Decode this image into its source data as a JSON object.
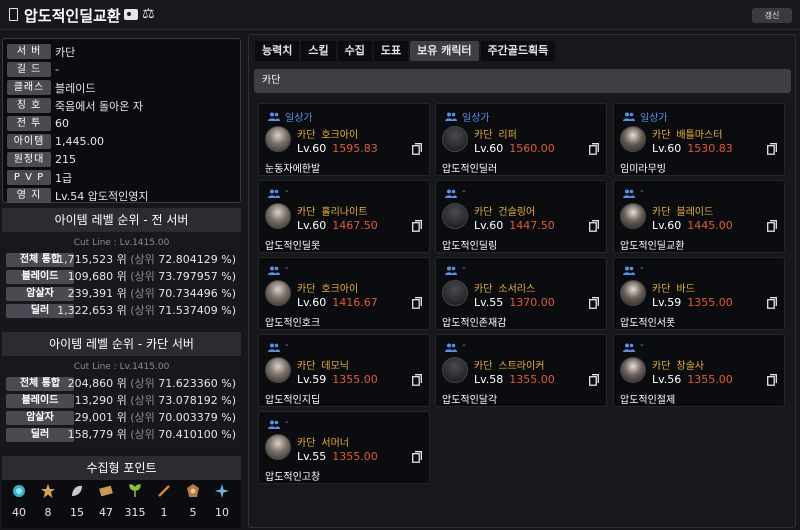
{
  "header": {
    "title": "압도적인딜교환",
    "refresh_label": "갱신"
  },
  "info": [
    {
      "label": "서 버",
      "value": "카단"
    },
    {
      "label": "길 드",
      "value": "-"
    },
    {
      "label": "클래스",
      "value": "블레이드"
    },
    {
      "label": "칭 호",
      "value": "죽음에서 돌아온 자"
    },
    {
      "label": "전 투",
      "value": "60"
    },
    {
      "label": "아이템",
      "value": "1,445.00"
    },
    {
      "label": "원정대",
      "value": "215"
    },
    {
      "label": "P V P",
      "value": "1급"
    },
    {
      "label": "영 지",
      "value": "Lv.54 압도적인영지"
    }
  ],
  "rank_all": {
    "title": "아이템 레벨 순위 - 전 서버",
    "cutline": "Cut Line : Lv.1415.00",
    "rows": [
      {
        "label": "전체 통합",
        "rank": "1,715,523 위",
        "pct_label": "(상위",
        "pct": "72.804129 %)"
      },
      {
        "label": "블레이드",
        "rank": "109,680 위",
        "pct_label": "(상위",
        "pct": "73.797957 %)"
      },
      {
        "label": "암살자",
        "rank": "239,391 위",
        "pct_label": "(상위",
        "pct": "70.734496 %)"
      },
      {
        "label": "딜러",
        "rank": "1,322,653 위",
        "pct_label": "(상위",
        "pct": "71.537409 %)"
      }
    ]
  },
  "rank_server": {
    "title": "아이템 레벨 순위 - 카단 서버",
    "cutline": "Cut Line : Lv.1415.00",
    "rows": [
      {
        "label": "전체 통합",
        "rank": "204,860 위",
        "pct_label": "(상위",
        "pct": "71.623360 %)"
      },
      {
        "label": "블레이드",
        "rank": "13,290 위",
        "pct_label": "(상위",
        "pct": "73.078192 %)"
      },
      {
        "label": "암살자",
        "rank": "29,001 위",
        "pct_label": "(상위",
        "pct": "70.003379 %)"
      },
      {
        "label": "딜러",
        "rank": "158,779 위",
        "pct_label": "(상위",
        "pct": "70.410100 %)"
      }
    ]
  },
  "collection": {
    "title": "수집형 포인트",
    "items": [
      {
        "icon": "seed-icon",
        "count": "40",
        "color": "#3fb0c9"
      },
      {
        "icon": "star-icon",
        "count": "8",
        "color": "#d8a04a"
      },
      {
        "icon": "leaf-icon",
        "count": "15",
        "color": "#c9c9c9"
      },
      {
        "icon": "painting-icon",
        "count": "47",
        "color": "#c79a55"
      },
      {
        "icon": "sprout-icon",
        "count": "315",
        "color": "#8fbf3a"
      },
      {
        "icon": "medal-icon",
        "count": "1",
        "color": "#d7892f"
      },
      {
        "icon": "emblem-icon",
        "count": "5",
        "color": "#b07a4a"
      },
      {
        "icon": "compass-icon",
        "count": "10",
        "color": "#6fb7e8"
      }
    ]
  },
  "tabs": [
    "능력치",
    "스킬",
    "수집",
    "도표",
    "보유 캐릭터",
    "주간골드획득"
  ],
  "active_tab": 4,
  "server_name": "카단",
  "characters": [
    {
      "guild": "일상가",
      "server": "카단",
      "cls": "호크아이",
      "lv": "Lv.60",
      "ilv": "1595.83",
      "name": "눈동자에한발"
    },
    {
      "guild": "일상가",
      "server": "카단",
      "cls": "리퍼",
      "lv": "Lv.60",
      "ilv": "1560.00",
      "name": "압도적인딜러"
    },
    {
      "guild": "일상가",
      "server": "카단",
      "cls": "배틀마스터",
      "lv": "Lv.60",
      "ilv": "1530.83",
      "name": "임미라무빙"
    },
    {
      "guild": "-",
      "server": "카단",
      "cls": "홀리나이트",
      "lv": "Lv.60",
      "ilv": "1467.50",
      "name": "압도적인딜못"
    },
    {
      "guild": "-",
      "server": "카단",
      "cls": "건슬링어",
      "lv": "Lv.60",
      "ilv": "1447.50",
      "name": "압도적인딜링"
    },
    {
      "guild": "-",
      "server": "카단",
      "cls": "블레이드",
      "lv": "Lv.60",
      "ilv": "1445.00",
      "name": "압도적인딜교환"
    },
    {
      "guild": "-",
      "server": "카단",
      "cls": "호크아이",
      "lv": "Lv.60",
      "ilv": "1416.67",
      "name": "압도적인호크"
    },
    {
      "guild": "-",
      "server": "카단",
      "cls": "소서리스",
      "lv": "Lv.55",
      "ilv": "1370.00",
      "name": "압도적인존재감"
    },
    {
      "guild": "-",
      "server": "카단",
      "cls": "바드",
      "lv": "Lv.59",
      "ilv": "1355.00",
      "name": "압도적인서폿"
    },
    {
      "guild": "-",
      "server": "카단",
      "cls": "데모닉",
      "lv": "Lv.59",
      "ilv": "1355.00",
      "name": "압도적인지딥"
    },
    {
      "guild": "-",
      "server": "카단",
      "cls": "스트라이커",
      "lv": "Lv.58",
      "ilv": "1355.00",
      "name": "압도적인달각"
    },
    {
      "guild": "-",
      "server": "카단",
      "cls": "창술사",
      "lv": "Lv.56",
      "ilv": "1355.00",
      "name": "압도적인절제"
    },
    {
      "guild": "-",
      "server": "카단",
      "cls": "서머너",
      "lv": "Lv.55",
      "ilv": "1355.00",
      "name": "압도적인고창"
    }
  ]
}
